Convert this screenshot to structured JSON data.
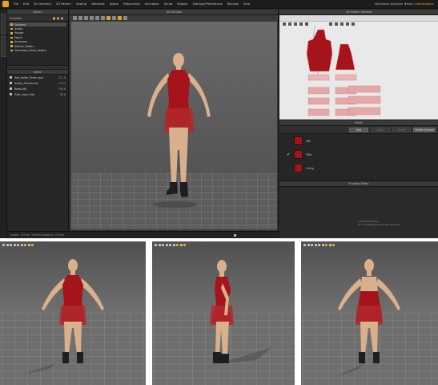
{
  "menubar": {
    "items": [
      "File",
      "Edit",
      "3D Garment",
      "2D Pattern",
      "Sewing",
      "Materials",
      "Avatar",
      "Retouching",
      "Animation",
      "Script",
      "Display",
      "Settings/Preferences",
      "Window",
      "Help"
    ],
    "app_title": "Marvelous Designer 4",
    "user_prefix": "Hello,",
    "user_name": "clothdesigner"
  },
  "library": {
    "title": "Library",
    "favorites_label": "Favorites",
    "folders": [
      "Garment",
      "Avatar",
      "Hanger",
      "Fabric",
      "Accessory",
      "Default_Pattern",
      "Sleeveless_Dress_Pattern"
    ],
    "list_header": "Name",
    "files": [
      {
        "name": "Red_Halter_Dress.zpac",
        "size": "221 K"
      },
      {
        "name": "Avatar_Female.avt",
        "size": "1.8 M"
      },
      {
        "name": "Boots.obj",
        "size": "356 K"
      },
      {
        "name": "Tulle_Layer.zfab",
        "size": "28 K"
      }
    ]
  },
  "view3d": {
    "title": "3D Window"
  },
  "view2d": {
    "title": "2D Pattern Window"
  },
  "fabric": {
    "title": "Fabric",
    "add_label": "Add",
    "copy_label": "Copy",
    "delete_label": "Delete",
    "unused_label": "Delete Unused",
    "items": [
      "Silk",
      "Tulle",
      "Lining"
    ]
  },
  "property": {
    "title": "Property Editor",
    "notice_line1": "Activate Windows",
    "notice_line2": "Go to Settings to activate Windows."
  },
  "status": {
    "text": "Avatar: 172 cm / Particle distance: 20 mm"
  },
  "colors": {
    "dress": "#a4141a",
    "skin": "#d9b08c",
    "accent": "#e8a317"
  }
}
